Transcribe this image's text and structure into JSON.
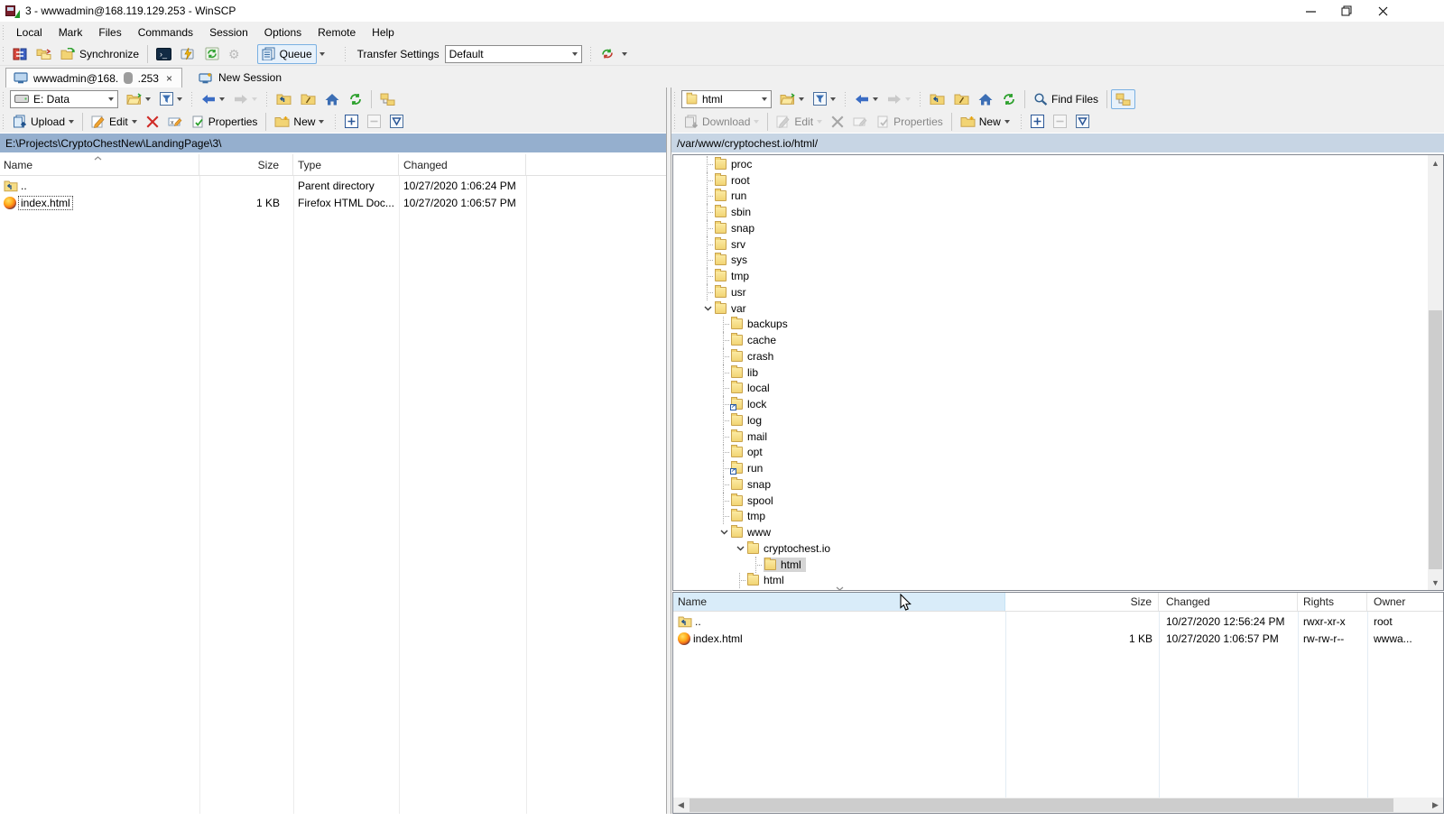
{
  "window": {
    "title": "3 - wwwadmin@168.119.129.253 - WinSCP"
  },
  "menu": {
    "items": [
      "Local",
      "Mark",
      "Files",
      "Commands",
      "Session",
      "Options",
      "Remote",
      "Help"
    ]
  },
  "toolbar": {
    "synchronize_label": "Synchronize",
    "queue_label": "Queue",
    "transfer_settings_label": "Transfer Settings",
    "transfer_settings_value": "Default"
  },
  "tabs": {
    "session_prefix": "wwwadmin@168.",
    "session_suffix": ".253",
    "close_glyph": "×",
    "new_session_label": "New Session"
  },
  "left_panel": {
    "drive_value": "E: Data",
    "upload_label": "Upload",
    "edit_label": "Edit",
    "properties_label": "Properties",
    "new_label": "New",
    "path": "E:\\Projects\\CryptoChestNew\\LandingPage\\3\\",
    "columns": [
      "Name",
      "Size",
      "Type",
      "Changed"
    ],
    "rows": [
      {
        "name": "..",
        "icon": "folder-up",
        "size": "",
        "type": "Parent directory",
        "changed": "10/27/2020 1:06:24 PM",
        "focused": false
      },
      {
        "name": "index.html",
        "icon": "firefox",
        "size": "1 KB",
        "type": "Firefox HTML Doc...",
        "changed": "10/27/2020 1:06:57 PM",
        "focused": true
      }
    ]
  },
  "right_panel": {
    "dir_value": "html",
    "find_files_label": "Find Files",
    "download_label": "Download",
    "edit_label": "Edit",
    "properties_label": "Properties",
    "new_label": "New",
    "path": "/var/www/cryptochest.io/html/",
    "tree": [
      {
        "label": "proc",
        "depth": 1
      },
      {
        "label": "root",
        "depth": 1
      },
      {
        "label": "run",
        "depth": 1
      },
      {
        "label": "sbin",
        "depth": 1
      },
      {
        "label": "snap",
        "depth": 1
      },
      {
        "label": "srv",
        "depth": 1
      },
      {
        "label": "sys",
        "depth": 1
      },
      {
        "label": "tmp",
        "depth": 1
      },
      {
        "label": "usr",
        "depth": 1
      },
      {
        "label": "var",
        "depth": 1,
        "expanded": true
      },
      {
        "label": "backups",
        "depth": 2
      },
      {
        "label": "cache",
        "depth": 2
      },
      {
        "label": "crash",
        "depth": 2
      },
      {
        "label": "lib",
        "depth": 2
      },
      {
        "label": "local",
        "depth": 2
      },
      {
        "label": "lock",
        "depth": 2,
        "symlink": true
      },
      {
        "label": "log",
        "depth": 2
      },
      {
        "label": "mail",
        "depth": 2
      },
      {
        "label": "opt",
        "depth": 2
      },
      {
        "label": "run",
        "depth": 2,
        "symlink": true
      },
      {
        "label": "snap",
        "depth": 2
      },
      {
        "label": "spool",
        "depth": 2
      },
      {
        "label": "tmp",
        "depth": 2
      },
      {
        "label": "www",
        "depth": 2,
        "expanded": true
      },
      {
        "label": "cryptochest.io",
        "depth": 3,
        "expanded": true
      },
      {
        "label": "html",
        "depth": 4,
        "selected": true
      },
      {
        "label": "html",
        "depth": 3
      }
    ],
    "columns": [
      "Name",
      "Size",
      "Changed",
      "Rights",
      "Owner"
    ],
    "rows": [
      {
        "name": "..",
        "icon": "folder-up",
        "size": "",
        "changed": "10/27/2020 12:56:24 PM",
        "rights": "rwxr-xr-x",
        "owner": "root"
      },
      {
        "name": "index.html",
        "icon": "firefox",
        "size": "1 KB",
        "changed": "10/27/2020 1:06:57 PM",
        "rights": "rw-rw-r--",
        "owner": "wwwa..."
      }
    ]
  }
}
